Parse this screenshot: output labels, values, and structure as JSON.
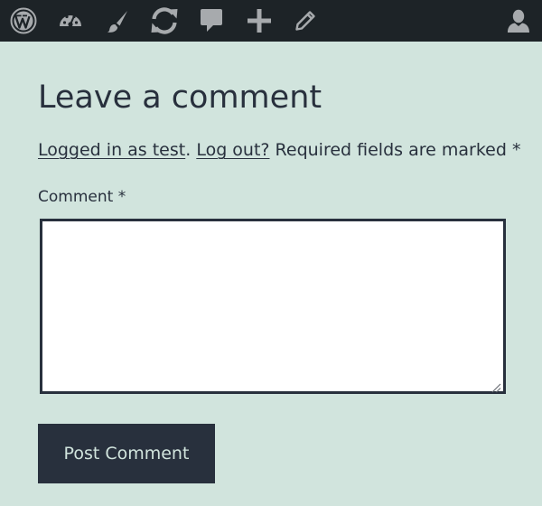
{
  "admin_bar": {
    "items": [
      {
        "icon": "wordpress-logo-icon"
      },
      {
        "icon": "dashboard-icon"
      },
      {
        "icon": "customize-brush-icon"
      },
      {
        "icon": "updates-icon"
      },
      {
        "icon": "comments-icon"
      },
      {
        "icon": "new-content-icon"
      },
      {
        "icon": "edit-icon"
      },
      {
        "icon": "user-account-icon"
      }
    ],
    "colors": {
      "background": "#1d2327",
      "icon": "#a7aaad"
    }
  },
  "comment_form": {
    "title": "Leave a comment",
    "logged_in_link": "Logged in as test",
    "separator": ".",
    "logout_link": "Log out?",
    "required_notice": "Required fields are marked",
    "required_mark": "*",
    "comment_label": "Comment",
    "comment_value": "",
    "submit_label": "Post Comment"
  },
  "colors": {
    "page_background": "#d1e4dd",
    "text": "#28303d",
    "button_background": "#28303d",
    "button_text": "#d1e4dd"
  }
}
